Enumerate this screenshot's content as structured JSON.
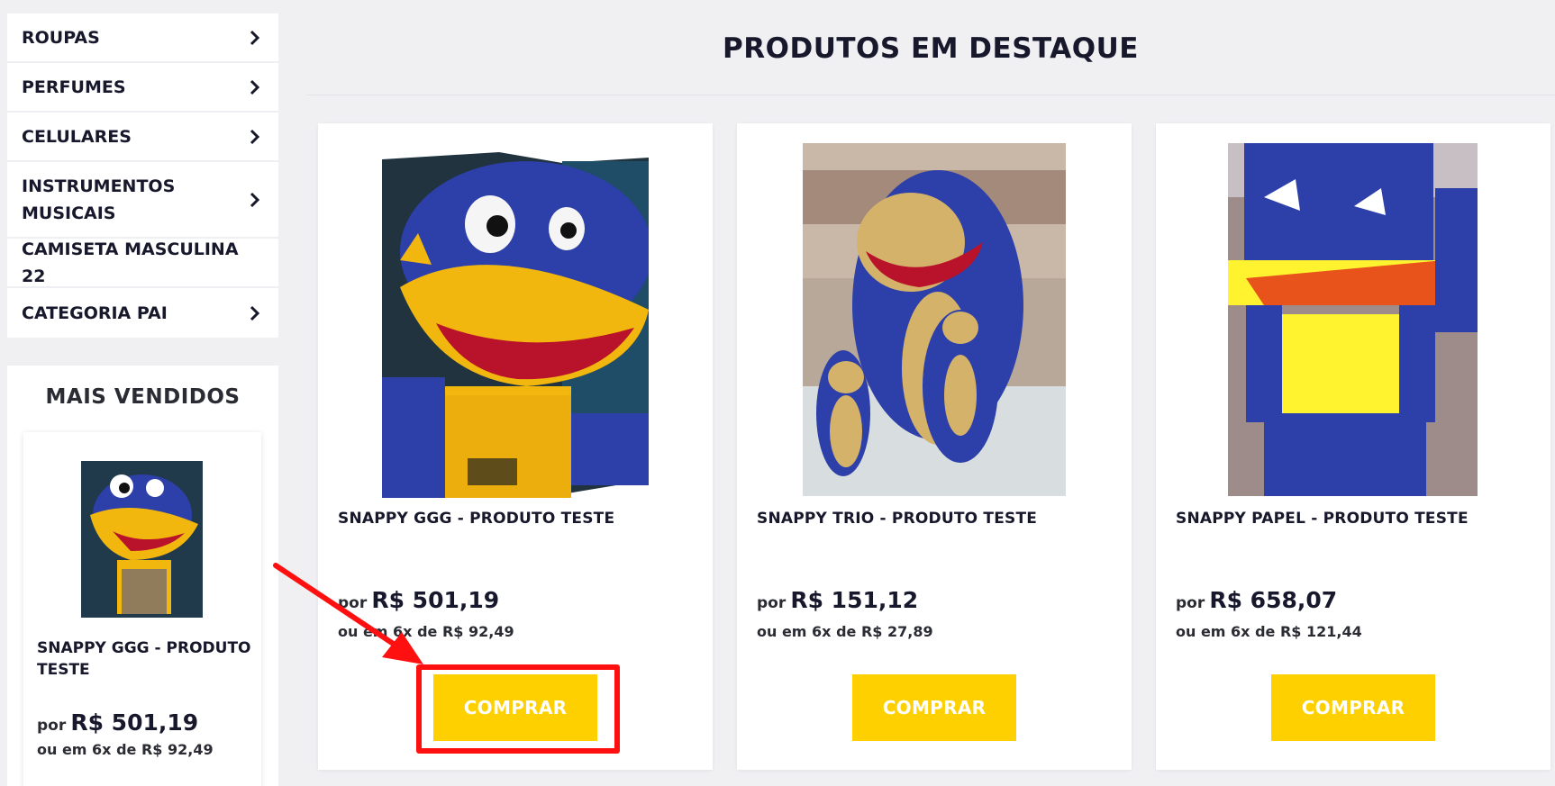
{
  "sidebar": {
    "categories": [
      {
        "label": "ROUPAS",
        "has_children": true
      },
      {
        "label": "PERFUMES",
        "has_children": true
      },
      {
        "label": "CELULARES",
        "has_children": true
      },
      {
        "label": "INSTRUMENTOS MUSICAIS",
        "has_children": true
      },
      {
        "label": "CAMISETA MASCULINA 22",
        "has_children": false
      },
      {
        "label": "CATEGORIA PAI",
        "has_children": true
      }
    ],
    "best_sellers": {
      "title": "MAIS VENDIDOS",
      "product": {
        "name": "SNAPPY GGG - PRODUTO TESTE",
        "price_prefix": "por",
        "price": "R$ 501,19",
        "installments": "ou em 6x de R$ 92,49"
      }
    }
  },
  "main": {
    "title": "PRODUTOS EM DESTAQUE",
    "products": [
      {
        "name": "SNAPPY GGG - PRODUTO TESTE",
        "price_prefix": "por",
        "price": "R$ 501,19",
        "installments": "ou em 6x de R$ 92,49",
        "buy_label": "COMPRAR"
      },
      {
        "name": "SNAPPY TRIO - PRODUTO TESTE",
        "price_prefix": "por",
        "price": "R$ 151,12",
        "installments": "ou em 6x de R$ 27,89",
        "buy_label": "COMPRAR"
      },
      {
        "name": "SNAPPY PAPEL - PRODUTO TESTE",
        "price_prefix": "por",
        "price": "R$ 658,07",
        "installments": "ou em 6x de R$ 121,44",
        "buy_label": "COMPRAR"
      }
    ]
  },
  "colors": {
    "accent": "#fed000",
    "text": "#17182b",
    "annotation": "#ff1010",
    "mascot_blue": "#2d3fa8",
    "mascot_yellow": "#f2b70f"
  }
}
